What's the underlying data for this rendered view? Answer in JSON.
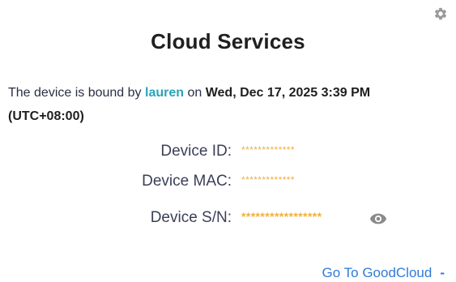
{
  "header": {
    "title": "Cloud Services",
    "settings_icon": "gear-icon"
  },
  "binding": {
    "prefix": "The device is bound by",
    "user": "lauren",
    "on": "on",
    "datetime": "Wed, Dec 17, 2025 3:39 PM",
    "timezone": "(UTC+08:00)"
  },
  "fields": {
    "device_id": {
      "label": "Device ID:",
      "value": "*************"
    },
    "device_mac": {
      "label": "Device MAC:",
      "value": "*************"
    },
    "device_sn": {
      "label": "Device S/N:",
      "value": "*****************",
      "reveal_icon": "eye-icon"
    }
  },
  "footer": {
    "link_label": "Go To GoodCloud",
    "link_icon": "dash-icon"
  },
  "colors": {
    "accent_teal": "#2aa5b9",
    "link_blue": "#2f7bd8",
    "masked_orange": "#f0b03f",
    "text_dark": "#1f1f1f"
  }
}
